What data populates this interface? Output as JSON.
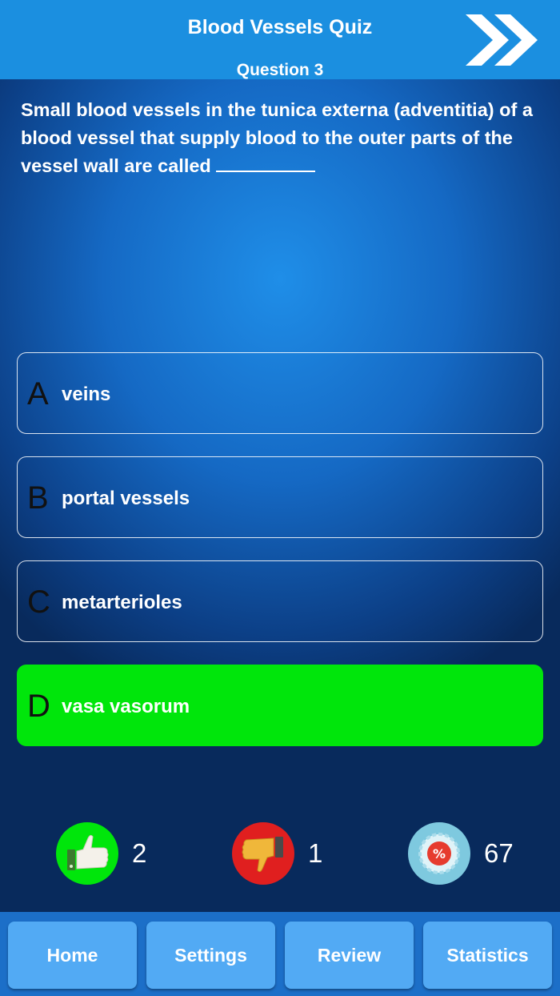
{
  "header": {
    "title": "Blood Vessels Quiz",
    "question_label": "Question 3"
  },
  "question": {
    "text": "Small blood vessels in the tunica externa (adventitia) of a blood vessel that supply blood to the outer parts of the vessel wall are called"
  },
  "answers": [
    {
      "letter": "A",
      "text": "veins"
    },
    {
      "letter": "B",
      "text": "portal vessels"
    },
    {
      "letter": "C",
      "text": "metarterioles"
    },
    {
      "letter": "D",
      "text": "vasa vasorum"
    }
  ],
  "stats": {
    "correct": "2",
    "wrong": "1",
    "percent": "67",
    "percent_symbol": "%"
  },
  "nav": {
    "home": "Home",
    "settings": "Settings",
    "review": "Review",
    "statistics": "Statistics"
  },
  "colors": {
    "header": "#1b8fe0",
    "correct_answer": "#00e60b",
    "nav_button": "#52aaf4",
    "footer": "#1c6fc8",
    "thumbs_up_circle": "#00e60b",
    "thumbs_down_circle": "#e01f1f",
    "percent_circle": "#7ec9df"
  },
  "icons": {
    "next": "double-chevron-right-icon",
    "correct": "thumbs-up-icon",
    "wrong": "thumbs-down-icon",
    "score": "percent-badge-icon"
  }
}
